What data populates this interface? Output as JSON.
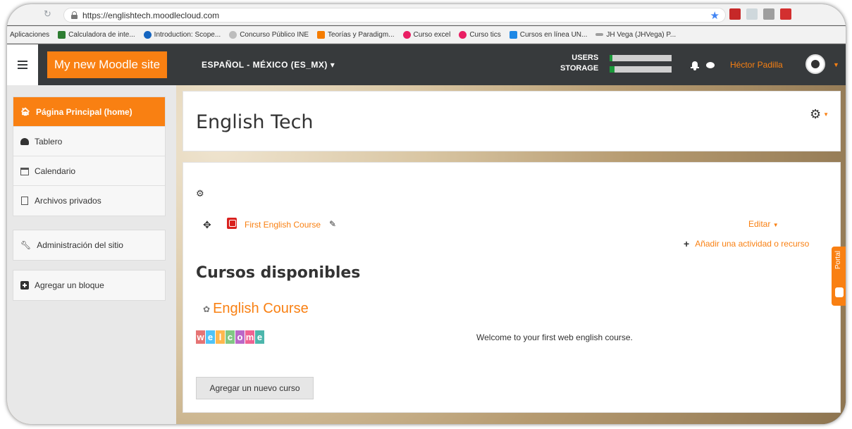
{
  "browser": {
    "url": "https://englishtech.moodlecloud.com",
    "bookmarks": [
      "Aplicaciones",
      "Calculadora de inte...",
      "Introduction: Scope...",
      "Concurso Público INE",
      "Teorías y Paradigm...",
      "Curso excel",
      "Curso tics",
      "Cursos en línea UN...",
      "JH Vega (JHVega) P..."
    ]
  },
  "navbar": {
    "brand": "My new Moodle site",
    "language": "ESPAÑOL - MÉXICO (ES_MX) ▾",
    "users_label": "USERS",
    "storage_label": "STORAGE",
    "users_usage": 0.05,
    "storage_usage": 0.08,
    "user_name": "Héctor Padilla"
  },
  "sidebar": {
    "items": [
      "Página Principal (home)",
      "Tablero",
      "Calendario",
      "Archivos privados"
    ],
    "admin": "Administración del sitio",
    "add_block": "Agregar un bloque"
  },
  "header": {
    "title": "English Tech"
  },
  "main": {
    "resource_name": "First English Course",
    "edit_label": "Editar",
    "add_activity": "Añadir una actividad o recurso",
    "available_title": "Cursos disponibles",
    "course_name": "English Course",
    "course_image_text": "Welcome",
    "course_summary": "Welcome to your first web english course.",
    "add_course_button": "Agregar un nuevo curso"
  },
  "portal_tab": "Portal",
  "colors": {
    "accent": "#f98012",
    "navbar": "#373a3c",
    "storage_fill": "#1a9a3a"
  }
}
